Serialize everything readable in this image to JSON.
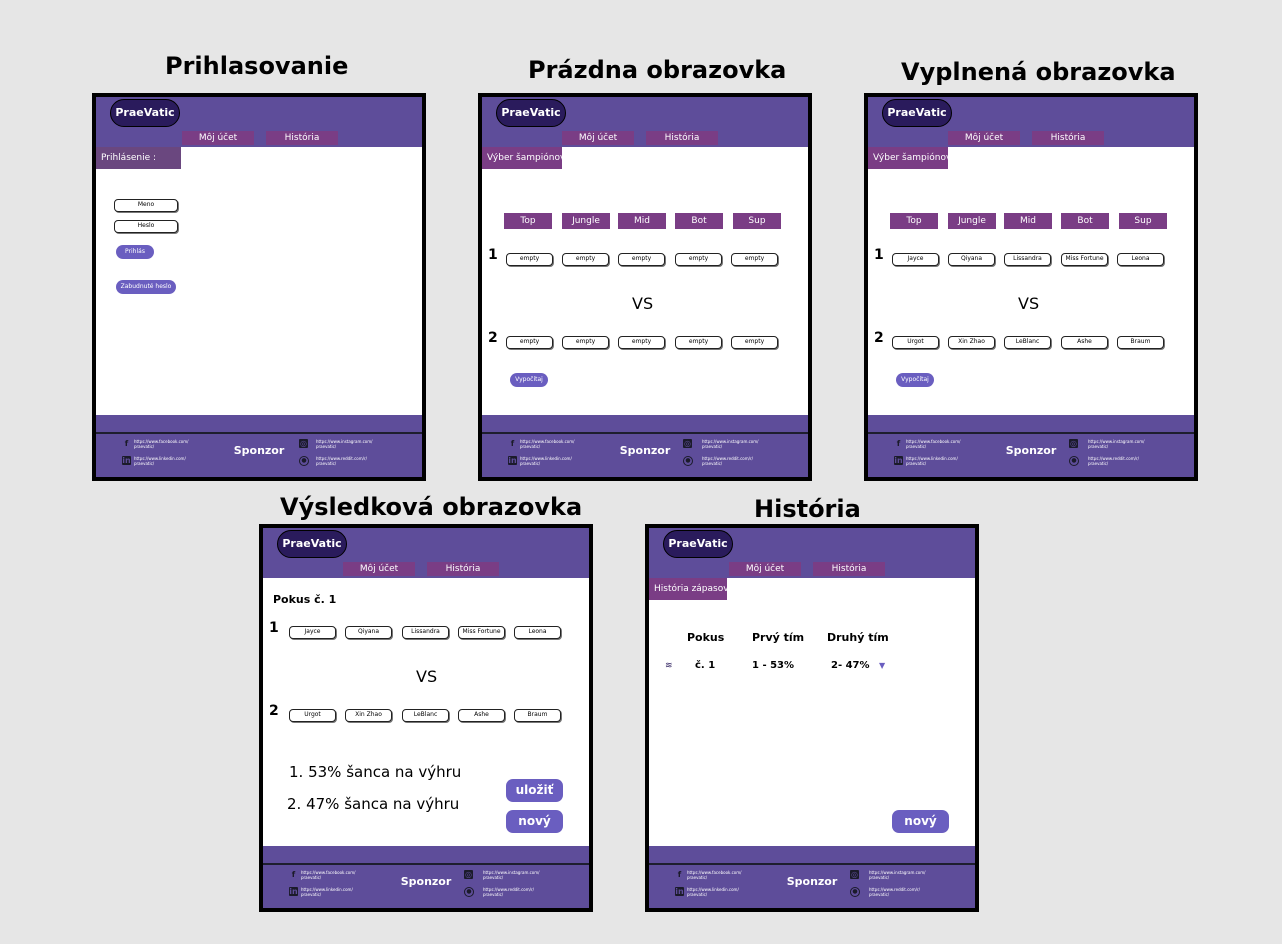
{
  "brand": "PraeVatic",
  "nav": {
    "account": "Môj účet",
    "history": "História"
  },
  "footer": {
    "sponsor": "Sponzor",
    "facebook": [
      "https://www.facebook.com/",
      "praevatic/"
    ],
    "instagram": [
      "https://www.instagram.com/",
      "praevatic/"
    ],
    "linkedin": [
      "https://www.linkedin.com/",
      "praevatic/"
    ],
    "reddit": [
      "https://www.reddit.com/r/",
      "praevatic/"
    ]
  },
  "titles": {
    "login": "Prihlasovanie",
    "empty": "Prázdna obrazovka",
    "filled": "Vyplnená obrazovka",
    "result": "Výsledková obrazovka",
    "history": "História"
  },
  "login": {
    "label": "Prihlásenie :",
    "name_field": "Meno",
    "password_field": "Heslo",
    "login_button": "Prihlás",
    "forgot_button": "Zabudnuté heslo"
  },
  "select_label": "Výber šampiónov:",
  "lanes": [
    "Top",
    "Jungle",
    "Mid",
    "Bot",
    "Sup"
  ],
  "vs": "VS",
  "team_numbers": [
    "1",
    "2"
  ],
  "empty_slot": "empty",
  "calc_button": "Vypočítaj",
  "team1": [
    "Jayce",
    "Qiyana",
    "Lissandra",
    "Miss Fortune",
    "Leona"
  ],
  "team2": [
    "Urgot",
    "Xin Zhao",
    "LeBlanc",
    "Ashe",
    "Braum"
  ],
  "result": {
    "attempt": "Pokus č. 1",
    "line1": "1. 53% šanca na výhru",
    "line2": "2. 47% šanca na výhru",
    "save_button": "uložiť",
    "new_button": "nový"
  },
  "history": {
    "label": "História zápasov :",
    "columns": [
      "Pokus",
      "Prvý tím",
      "Druhý tím"
    ],
    "rows": [
      {
        "attempt": "č. 1",
        "first": "1 - 53%",
        "second": "2- 47%"
      }
    ],
    "new_button": "nový"
  },
  "colors": {
    "header": "#5e4d9a",
    "logo": "#2a1b5c",
    "nav": "#7a3d85",
    "button": "#6a5ec0"
  }
}
